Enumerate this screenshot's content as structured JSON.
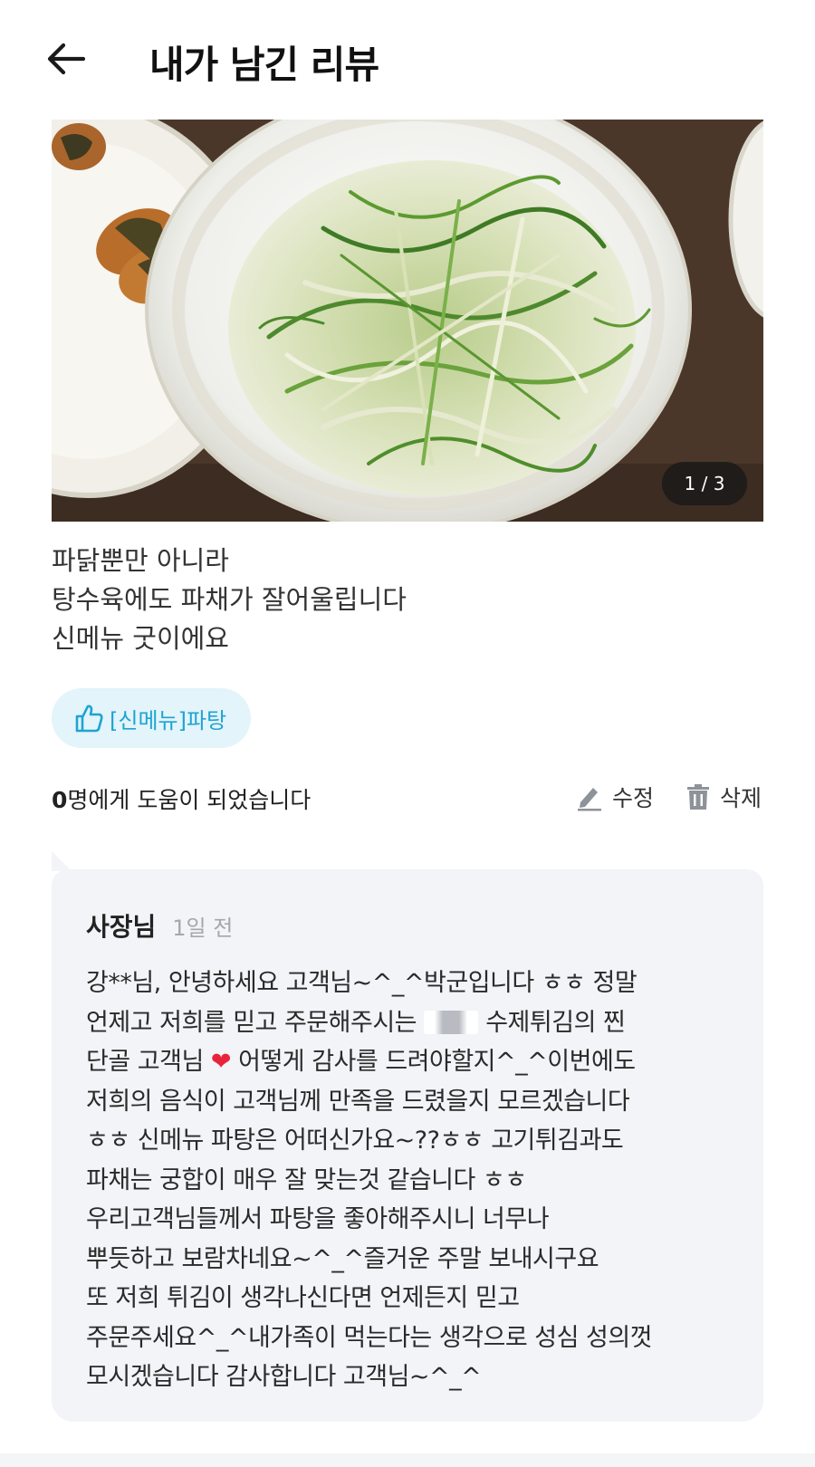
{
  "header": {
    "title": "내가 남긴 리뷰",
    "back_icon": "arrow-left-icon"
  },
  "photo": {
    "counter": "1 / 3"
  },
  "review": {
    "lines": [
      "파닭뿐만 아니라",
      "탕수육에도 파채가 잘어울립니다",
      "신메뉴 굿이에요"
    ]
  },
  "menu_chip": {
    "label": "[신메뉴]파탕",
    "icon": "thumbs-up-icon",
    "color": "#1ea4d2"
  },
  "helpful": {
    "count": "0",
    "text": "명에게 도움이 되었습니다"
  },
  "actions": {
    "edit_label": "수정",
    "delete_label": "삭제"
  },
  "reply": {
    "author": "사장님",
    "time": "1일 전",
    "lines": [
      "강**님, 안녕하세요 고객님~^_^박군입니다 ㅎㅎ 정말",
      "언제고 저희를 믿고 주문해주시는",
      "수제튀김의 찐",
      "단골 고객님",
      "어떻게 감사를 드려야할지^_^이번에도",
      "저희의 음식이 고객님께 만족을 드렸을지 모르겠습니다",
      "ㅎㅎ 신메뉴 파탕은 어떠신가요~??ㅎㅎ 고기튀김과도",
      "파채는 궁합이 매우 잘 맞는것 같습니다 ㅎㅎ",
      "우리고객님들께서 파탕을 좋아해주시니 너무나",
      "뿌듯하고 보람차네요~^_^즐거운 주말 보내시구요",
      "또 저희 튀김이 생각나신다면 언제든지 믿고",
      "주문주세요^_^내가족이 먹는다는 생각으로 성심 성의껏",
      "모시겠습니다 감사합니다 고객님~^_^"
    ],
    "heart": "❤"
  }
}
